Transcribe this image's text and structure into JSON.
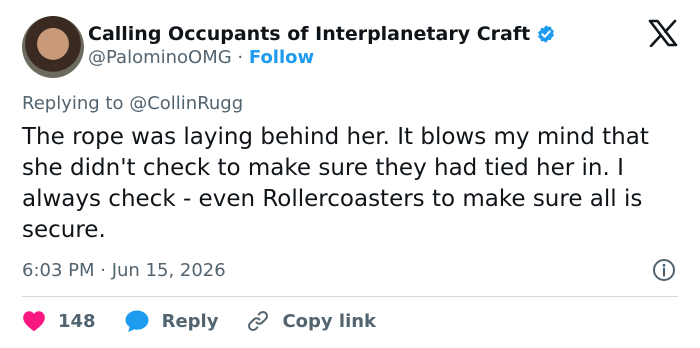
{
  "author": {
    "display_name": "Calling Occupants of Interplanetary Craft",
    "handle": "@PalominoOMG",
    "separator": " · ",
    "follow_label": "Follow"
  },
  "reply_context": "Replying to @CollinRugg",
  "tweet": {
    "text": "The rope was laying behind her. It blows my mind that she didn't check to make sure they had tied her in. I always check - even Rollercoasters to make sure all is secure.",
    "timestamp": "6:03 PM · Jun 15, 2026"
  },
  "actions": {
    "like_count": "148",
    "reply_label": "Reply",
    "copy_link_label": "Copy link"
  },
  "colors": {
    "verified": "#1d9bf0",
    "like": "#f91880",
    "reply_icon": "#1d9bf0",
    "link": "#1d9bf0",
    "secondary_text": "#536471"
  }
}
